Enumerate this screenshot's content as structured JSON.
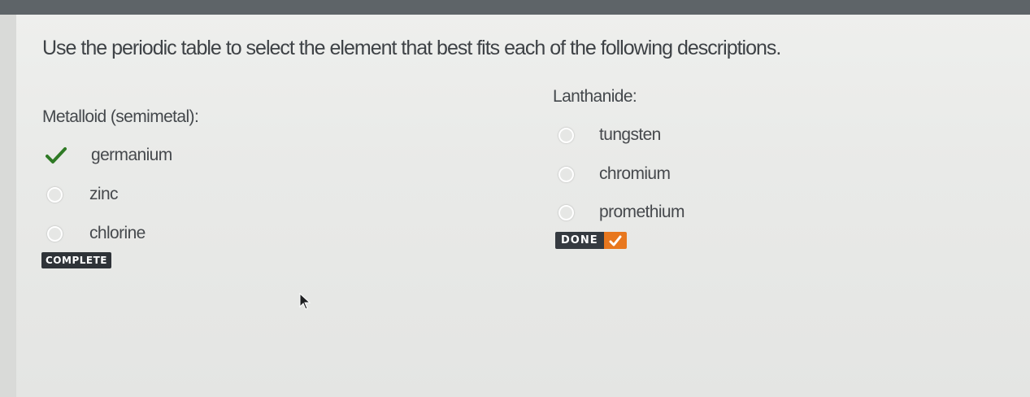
{
  "instructions": "Use the periodic table to select the element that best fits each of the following descriptions.",
  "question1": {
    "label": "Metalloid (semimetal):",
    "options": [
      {
        "label": "germanium",
        "state": "correct-selected",
        "icon": "checkmark-icon"
      },
      {
        "label": "zinc",
        "state": "unselected",
        "icon": "radio-icon"
      },
      {
        "label": "chlorine",
        "state": "unselected",
        "icon": "radio-icon"
      }
    ],
    "status": "COMPLETE"
  },
  "question2": {
    "label": "Lanthanide:",
    "options": [
      {
        "label": "tungsten",
        "state": "unselected",
        "icon": "radio-icon"
      },
      {
        "label": "chromium",
        "state": "unselected",
        "icon": "radio-icon"
      },
      {
        "label": "promethium",
        "state": "unselected",
        "icon": "radio-icon"
      }
    ],
    "done_button": {
      "label": "DONE",
      "icon": "checkmark-icon"
    }
  },
  "colors": {
    "check_green": "#2f7a25",
    "done_orange": "#e8771e",
    "badge_dark": "#2f3338"
  }
}
